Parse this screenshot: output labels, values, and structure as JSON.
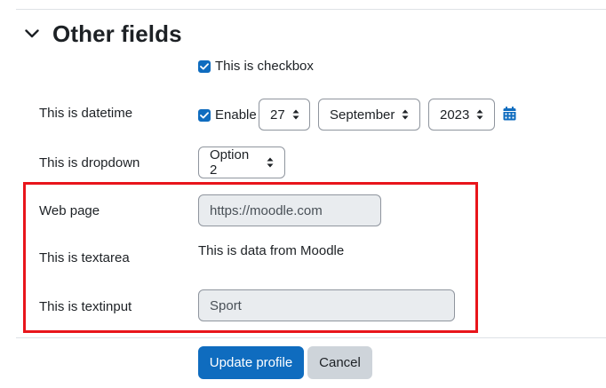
{
  "section": {
    "title": "Other fields",
    "icon": "chevron-down-icon"
  },
  "checkbox_field": {
    "label": "This is checkbox",
    "checked": true
  },
  "datetime_field": {
    "label": "This is datetime",
    "enable_label": "Enable",
    "enable_checked": true,
    "day": "27",
    "month": "September",
    "year": "2023",
    "calendar_icon": "calendar-icon"
  },
  "dropdown_field": {
    "label": "This is dropdown",
    "value": "Option 2"
  },
  "webpage_field": {
    "label": "Web page",
    "value": "https://moodle.com"
  },
  "textarea_field": {
    "label": "This is textarea",
    "value": "This is data from Moodle"
  },
  "textinput_field": {
    "label": "This is textinput",
    "value": "Sport"
  },
  "buttons": {
    "update_label": "Update profile",
    "cancel_label": "Cancel"
  },
  "colors": {
    "primary": "#0f6cbf",
    "highlight_border": "#e8151b",
    "readonly_bg": "#e9ecef",
    "secondary_button": "#ced4da"
  }
}
